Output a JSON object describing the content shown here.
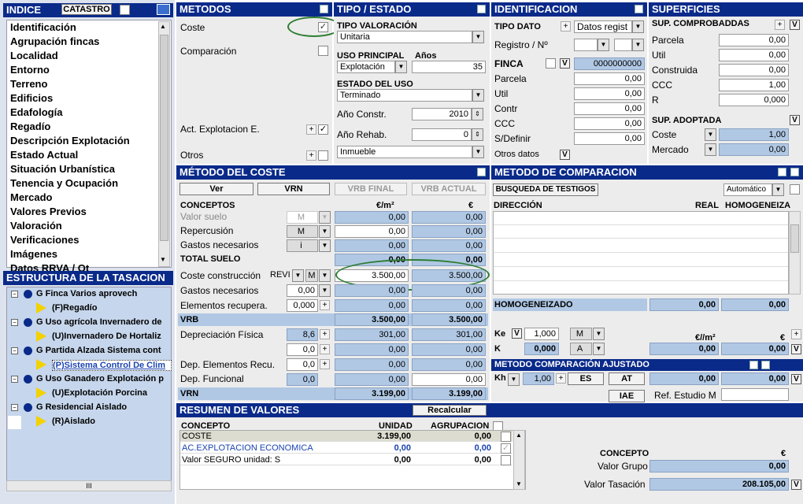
{
  "indice": {
    "title": "INDICE",
    "catastro": "CATASTRO",
    "items": [
      "Identificación",
      "Agrupación fincas",
      "Localidad",
      "Entorno",
      "Terreno",
      "Edificios",
      "Edafología",
      "Regadío",
      "Descripción Explotación",
      "Estado Actual",
      "Situación Urbanística",
      "Tenencia y Ocupación",
      "Mercado",
      "Valores Previos",
      "Valoración",
      "Verificaciones",
      "Imágenes",
      "Datos RRVA / Ot"
    ],
    "selected": "Valoración"
  },
  "estructura": {
    "title": "ESTRUCTURA DE LA TASACION",
    "items": [
      {
        "label": "G Finca Varios aprovech",
        "level": 0
      },
      {
        "label": "(F)Regadío",
        "level": 1
      },
      {
        "label": "G Uso agrícola Invernadero de",
        "level": 0
      },
      {
        "label": "(U)Invernadero De Hortaliz",
        "level": 1
      },
      {
        "label": "G Partida Alzada Sistema cont",
        "level": 0
      },
      {
        "label": "(P)Sistema Control De Clim",
        "level": 1,
        "selected": true
      },
      {
        "label": "G Uso Ganadero Explotación p",
        "level": 0
      },
      {
        "label": "(U)Explotación Porcina",
        "level": 1
      },
      {
        "label": "G Residencial Aislado",
        "level": 0
      },
      {
        "label": "(R)Aislado",
        "level": 1
      }
    ],
    "hscroll": "III"
  },
  "metodos": {
    "title": "METODOS",
    "coste": "Coste",
    "comparacion": "Comparación",
    "act": "Act. Explotacion E.",
    "otros": "Otros"
  },
  "tipo": {
    "title": "TIPO / ESTADO",
    "tipo_valoracion_label": "TIPO VALORACIÓN",
    "tipo_valoracion": "Unitaria",
    "uso_principal_label": "USO PRINCIPAL",
    "anos_label": "Años",
    "uso_principal": "Explotación",
    "anos": "35",
    "estado_uso_label": "ESTADO DEL USO",
    "estado_uso": "Terminado",
    "ano_constr_label": "Año Constr.",
    "ano_constr": "2010",
    "ano_rehab_label": "Año Rehab.",
    "ano_rehab": "0",
    "tipo_inmueble": "Inmueble"
  },
  "ident": {
    "title": "IDENTIFICACION",
    "tipo_dato_label": "TIPO DATO",
    "tipo_dato": "Datos regist",
    "registro_label": "Registro / Nº",
    "finca_label": "FINCA",
    "finca_value": "0000000000",
    "rows": [
      {
        "label": "Parcela",
        "value": "0,00"
      },
      {
        "label": "Util",
        "value": "0,00"
      },
      {
        "label": "Contr",
        "value": "0,00"
      },
      {
        "label": "CCC",
        "value": "0,00"
      },
      {
        "label": "S/Definir",
        "value": "0,00"
      }
    ],
    "otros_datos": "Otros datos"
  },
  "superficies": {
    "title": "SUPERFICIES",
    "comprobadas_label": "SUP. COMPROBADDAS",
    "comprobadas": [
      {
        "label": "Parcela",
        "value": "0,00"
      },
      {
        "label": "Util",
        "value": "0,00"
      },
      {
        "label": "Construida",
        "value": "0,00"
      },
      {
        "label": "CCC",
        "value": "1,00"
      },
      {
        "label": "R",
        "value": "0,000"
      }
    ],
    "adoptada_label": "SUP. ADOPTADA",
    "adoptada": [
      {
        "label": "Coste",
        "value": "1,00"
      },
      {
        "label": "Mercado",
        "value": "0,00"
      }
    ]
  },
  "coste": {
    "title": "MÉTODO DEL COSTE",
    "buttons": [
      "Ver",
      "VRN",
      "VRB FINAL",
      "VRB ACTUAL"
    ],
    "conceptos_label": "CONCEPTOS",
    "col1": "€/m²",
    "col2": "€",
    "valor_suelo": {
      "label": "Valor suelo",
      "sel": "M",
      "v1": "0,00",
      "v2": "0,00"
    },
    "repercusion": {
      "label": "Repercusión",
      "sel": "M",
      "v1": "0,00",
      "v2": "0,00"
    },
    "gastos_nec": {
      "label": "Gastos necesarios",
      "sel": "i",
      "v1": "0,00",
      "v2": "0,00"
    },
    "total_suelo": {
      "label": "TOTAL SUELO",
      "v1": "0,00",
      "v2": "0,00"
    },
    "coste_constr": {
      "label": "Coste construcción",
      "sel1": "REVI",
      "sel2": "M",
      "v1": "3.500,00",
      "v2": "3.500,00"
    },
    "gastos_nec2": {
      "label": "Gastos necesarios",
      "input": "0,00",
      "v1": "0,00",
      "v2": "0,00"
    },
    "elementos": {
      "label": "Elementos recupera.",
      "input": "0,000",
      "v1": "0,00",
      "v2": "0,00"
    },
    "vrb": {
      "label": "VRB",
      "v1": "3.500,00",
      "v2": "3.500,00"
    },
    "depreciacion": {
      "label": "Depreciación Física",
      "input": "8,6",
      "v1": "301,00",
      "v2": "301,00"
    },
    "extra_row": {
      "input": "0,0",
      "v1": "0,00",
      "v2": "0,00"
    },
    "dep_elem": {
      "label": "Dep. Elementos Recu.",
      "input": "0,0",
      "v1": "0,00",
      "v2": "0,00"
    },
    "dep_func": {
      "label": "Dep. Funcional",
      "input": "0,0",
      "v1": "0,00",
      "v2": "0,00"
    },
    "vrn": {
      "label": "VRN",
      "v1": "3.199,00",
      "v2": "3.199,00"
    }
  },
  "comparacion": {
    "title": "METODO DE COMPARACION",
    "busqueda": "BUSQUEDA DE TESTIGOS",
    "modo": "Automático",
    "direccion": "DIRECCIÓN",
    "real": "REAL",
    "homog": "HOMOGENEIZA",
    "homogeneizado_label": "HOMOGENEIZADO",
    "homogeneizado_v1": "0,00",
    "homogeneizado_v2": "0,00",
    "ke_label": "Ke",
    "ke_value": "1,000",
    "ke_sel": "M",
    "k_label": "K",
    "k_value": "0,000",
    "k_sel": "A",
    "col_m2": "€//m²",
    "col_eur": "€",
    "k_v1": "0,00",
    "k_v2": "0,00"
  },
  "ajustado": {
    "title": "METODO COMPARACIÓN AJUSTADO",
    "kh_label": "Kh",
    "kh_value": "1,00",
    "es": "ES",
    "at": "AT",
    "v1": "0,00",
    "v2": "0,00",
    "iae": "IAE",
    "ref_label": "Ref. Estudio M"
  },
  "resumen": {
    "title": "RESUMEN DE VALORES",
    "recalcular": "Recalcular",
    "concepto_h": "CONCEPTO",
    "unidad_h": "UNIDAD",
    "agrupacion_h": "AGRUPACION",
    "rows": [
      {
        "concepto": "COSTE",
        "unidad": "3.199,00",
        "agrupacion": "0,00"
      },
      {
        "concepto": "AC.EXPLOTACION ECONOMICA",
        "unidad": "0,00",
        "agrupacion": "0,00"
      },
      {
        "concepto": "Valor SEGURO unidad: S",
        "unidad": "0,00",
        "agrupacion": "0,00"
      }
    ],
    "concepto2": "CONCEPTO",
    "euro": "€",
    "valor_grupo_label": "Valor Grupo",
    "valor_grupo": "0,00",
    "valor_tasacion_label": "Valor Tasación",
    "valor_tasacion": "208.105,00"
  },
  "colors": {
    "header": "#0a2a8a",
    "field_blue": "#b0c8e4",
    "highlight": "#2e7d32"
  }
}
